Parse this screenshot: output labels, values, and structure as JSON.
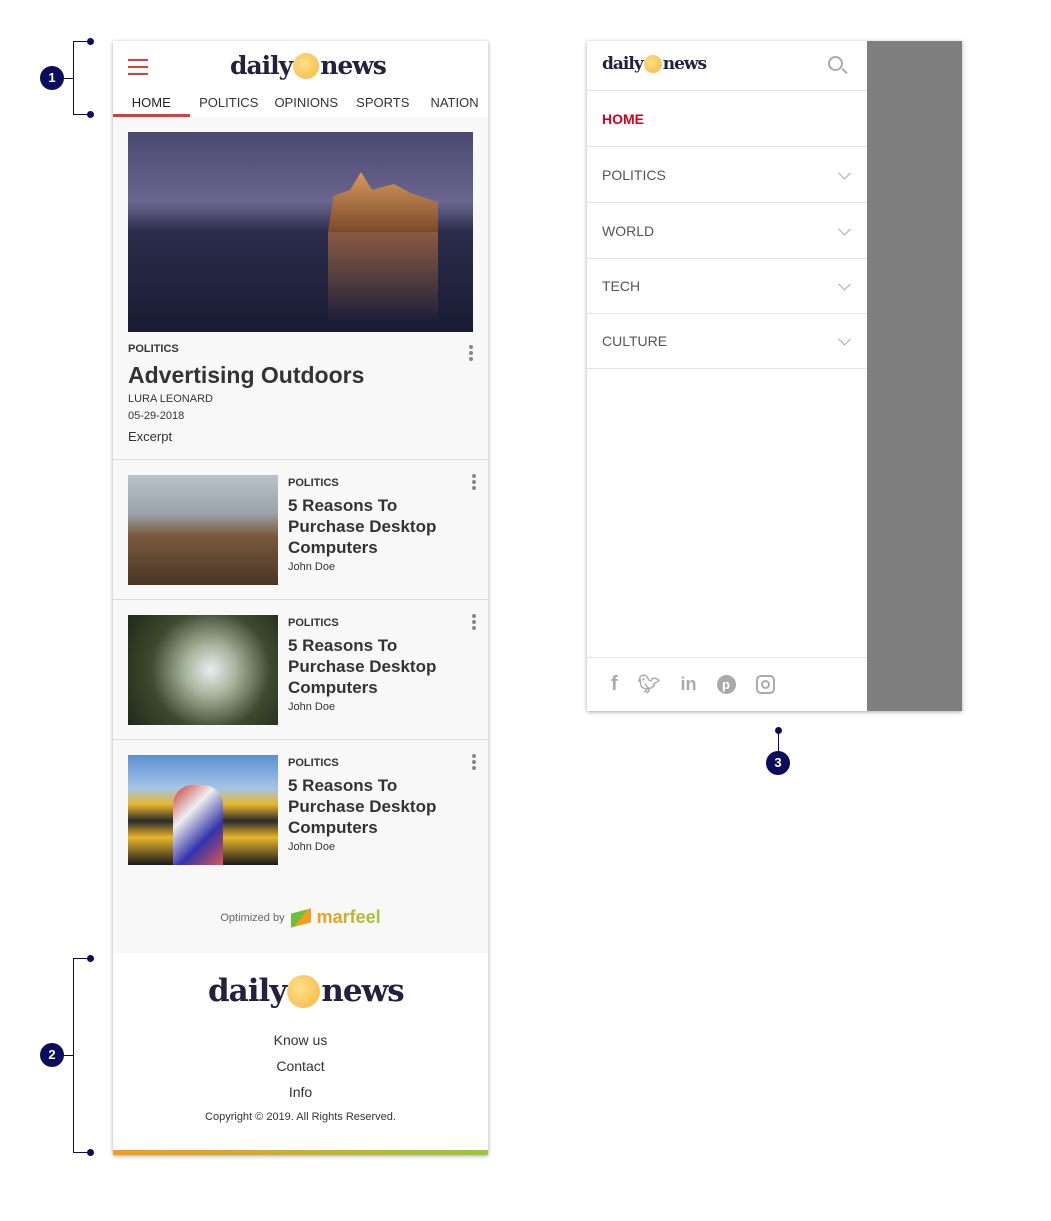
{
  "header": {
    "logo_left": "daily",
    "logo_right": "news",
    "tabs": [
      "HOME",
      "POLITICS",
      "OPINIONS",
      "SPORTS",
      "NATION"
    ]
  },
  "hero": {
    "category": "POLITICS",
    "title": "Advertising Outdoors",
    "author": "LURA LEONARD",
    "date": "05-29-2018",
    "excerpt": "Excerpt"
  },
  "articles": [
    {
      "category": "POLITICS",
      "title": "5 Reasons To Purchase Desktop Computers",
      "author": "John Doe"
    },
    {
      "category": "POLITICS",
      "title": "5 Reasons To Purchase Desktop Computers",
      "author": "John Doe"
    },
    {
      "category": "POLITICS",
      "title": "5 Reasons To Purchase Desktop Computers",
      "author": "John Doe"
    }
  ],
  "optimized": {
    "label": "Optimized by",
    "brand": "marfeel"
  },
  "footer": {
    "links": [
      "Know us",
      "Contact",
      "Info"
    ],
    "copyright": "Copyright © 2019. All Rights Reserved."
  },
  "drawer": {
    "items": [
      "HOME",
      "POLITICS",
      "WORLD",
      "TECH",
      "CULTURE"
    ],
    "social": [
      "facebook-icon",
      "twitter-icon",
      "linkedin-icon",
      "pinterest-icon",
      "instagram-icon"
    ]
  },
  "annotations": [
    "1",
    "2",
    "3"
  ],
  "colors": {
    "accent": "#e03c3c",
    "menu_active": "#d0021b",
    "logo": "#24213f",
    "annotation": "#0c0c5c"
  }
}
